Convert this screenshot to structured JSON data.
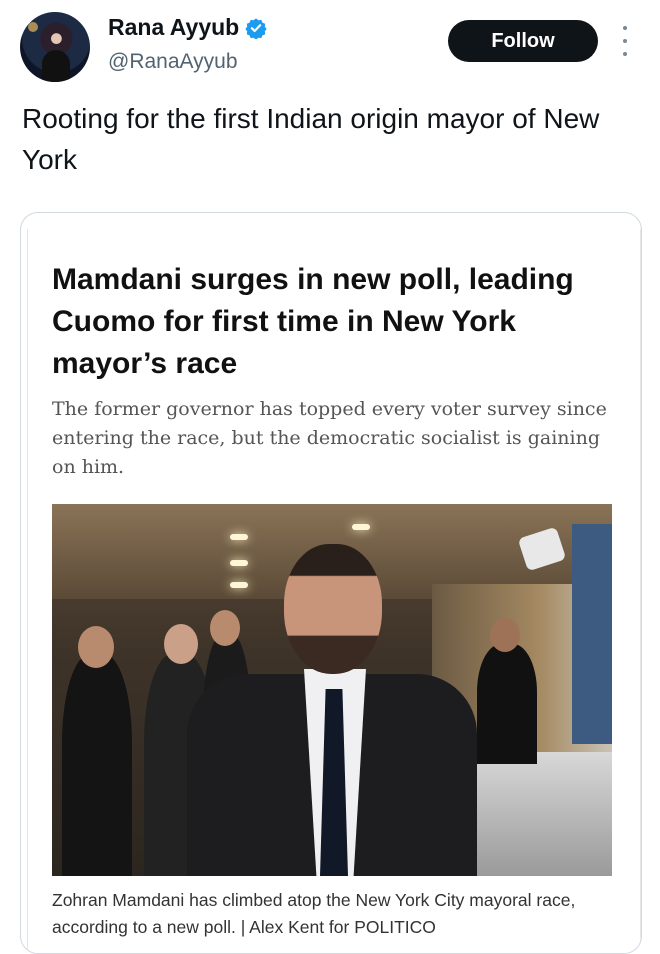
{
  "author": {
    "name": "Rana Ayyub",
    "handle": "@RanaAyyub",
    "verified": true,
    "avatar_icon": "profile-photo"
  },
  "actions": {
    "follow_label": "Follow",
    "more_icon": "more-vertical-icon"
  },
  "tweet": {
    "text": "Rooting for the first Indian origin mayor of New York"
  },
  "card": {
    "headline": "Mamdani surges in new poll, leading Cuomo for first time in New York mayor’s race",
    "dek": "The former governor has topped every voter survey since entering the race, but the democratic socialist is gaining on him.",
    "caption": "Zohran Mamdani has climbed atop the New York City mayoral race, according to a new poll. | Alex Kent for POLITICO"
  },
  "colors": {
    "verified_badge": "#1d9bf0",
    "follow_button_bg": "#0f1419",
    "text_primary": "#0f1419",
    "text_secondary": "#536471"
  }
}
